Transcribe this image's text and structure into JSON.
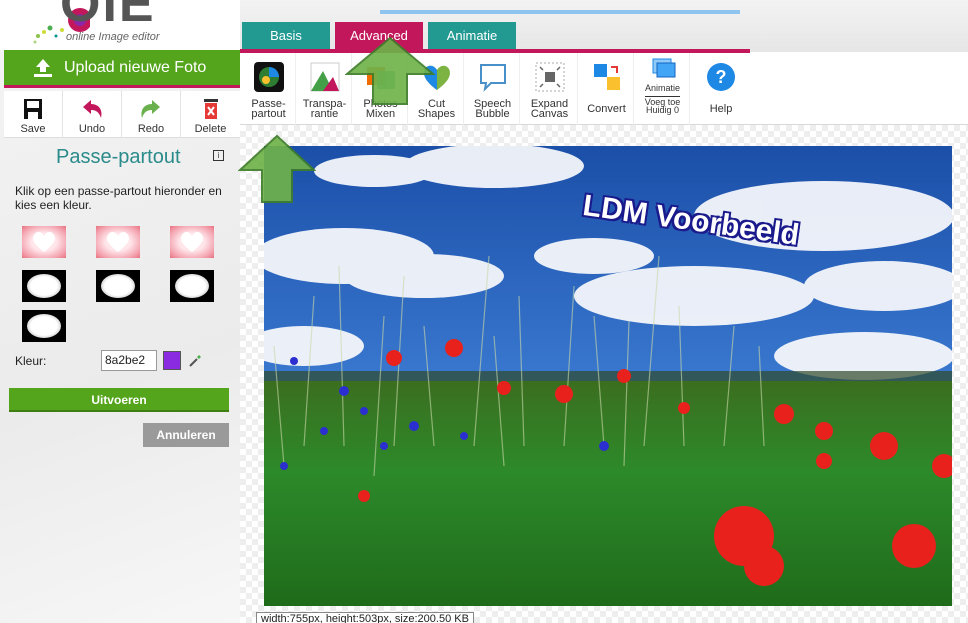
{
  "logo": {
    "text": "OIE",
    "subtitle": "online Image editor"
  },
  "upload_button": {
    "label": "Upload nieuwe Foto"
  },
  "left_toolbar": [
    {
      "label": "Save",
      "icon": "save-icon"
    },
    {
      "label": "Undo",
      "icon": "undo-icon"
    },
    {
      "label": "Redo",
      "icon": "redo-icon"
    },
    {
      "label": "Delete",
      "icon": "delete-icon"
    }
  ],
  "panel": {
    "title": "Passe-partout",
    "description": "Klik op een passe-partout hieronder en kies een kleur.",
    "kleur_label": "Kleur:",
    "kleur_value": "8a2be2",
    "kleur_color": "#8a2be2",
    "apply_button": "Uitvoeren",
    "cancel_button": "Annuleren"
  },
  "tabs": [
    {
      "label": "Basis",
      "active": false
    },
    {
      "label": "Advanced",
      "active": true
    },
    {
      "label": "Animatie",
      "active": false
    }
  ],
  "ribbon": {
    "passepartout": "Passe-\npartout",
    "transparantie": "Transpa-\nrantie",
    "photos_mixen": "Photos\nMixen",
    "cut_shapes": "Cut\nShapes",
    "speech_bubble": "Speech\nBubble",
    "expand_canvas": "Expand\nCanvas",
    "convert": "Convert",
    "animatie_label": "Animatie",
    "voeg_toe": "Voeg toe\nHuidig 0",
    "help": "Help"
  },
  "photo": {
    "overlay_text": "LDM Voorbeeld"
  },
  "status": {
    "text": "width:755px, height:503px, size:200.50 KB"
  },
  "colors": {
    "green": "#55a51c",
    "teal": "#229a91",
    "magenta": "#c2185b"
  }
}
